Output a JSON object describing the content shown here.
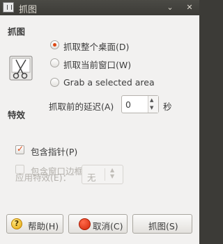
{
  "window": {
    "title": "抓图",
    "menu_arrow": "⌄",
    "close": "✕"
  },
  "capture_section": {
    "heading": "抓图",
    "options": [
      {
        "label": "抓取整个桌面(D)",
        "checked": true
      },
      {
        "label": "抓取当前窗口(W)",
        "checked": false
      },
      {
        "label": "Grab a selected area",
        "checked": false
      }
    ],
    "delay_label": "抓取前的延迟(A)",
    "delay_value": "0",
    "delay_unit": "秒"
  },
  "effects_section": {
    "heading": "特效",
    "include_pointer": {
      "label": "包含指针(P)",
      "checked": true
    },
    "include_border": {
      "label": "包含窗口边框(B)",
      "checked": false,
      "disabled": true
    },
    "apply_effect_label": "应用特效(E)：",
    "apply_effect_value": "无"
  },
  "buttons": {
    "help": "帮助(H)",
    "help_icon_glyph": "?",
    "cancel": "取消(C)",
    "capture": "抓图(S)"
  },
  "colors": {
    "accent": "#dd4814",
    "titlebar": "#3c3b37",
    "background": "#f2f1f0"
  }
}
